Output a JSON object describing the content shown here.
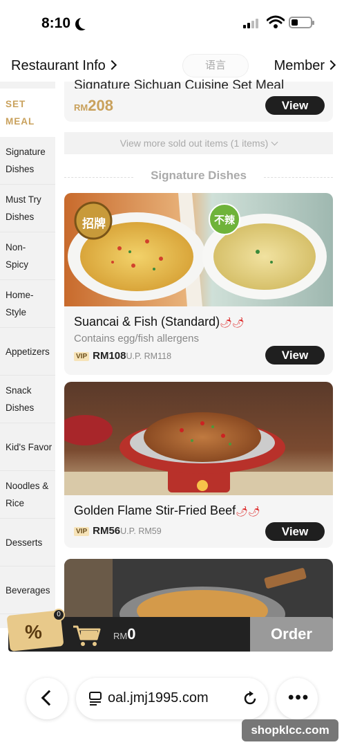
{
  "status_bar": {
    "time": "8:10"
  },
  "header": {
    "restaurant_info": "Restaurant Info",
    "language": "语言",
    "member": "Member"
  },
  "sidebar": {
    "items": [
      {
        "label": "SET MEAL",
        "active": true
      },
      {
        "label": "Signature Dishes"
      },
      {
        "label": "Must Try Dishes"
      },
      {
        "label": "Non-Spicy"
      },
      {
        "label": "Home-Style"
      },
      {
        "label": "Appetizers"
      },
      {
        "label": "Snack Dishes"
      },
      {
        "label": "Kid's Favor"
      },
      {
        "label": "Noodles & Rice"
      },
      {
        "label": "Desserts"
      },
      {
        "label": "Beverages"
      }
    ]
  },
  "set_meal_card": {
    "title": "Signature Sichuan Cuisine Set Meal",
    "currency": "RM",
    "price": "208",
    "view_label": "View"
  },
  "sold_out": {
    "label": "View more sold out items (1 items)"
  },
  "section": {
    "title": "Signature Dishes"
  },
  "dishes": [
    {
      "name": "Suancai & Fish (Standard)",
      "allergen": "Contains egg/fish allergens",
      "vip": "VIP",
      "vip_price": "RM108",
      "up_price": "U.P. RM118",
      "view_label": "View",
      "badge_left": "招牌",
      "badge_right": "不辣"
    },
    {
      "name": "Golden Flame Stir-Fried Beef",
      "vip": "VIP",
      "vip_price": "RM56",
      "up_price": "U.P. RM59",
      "view_label": "View"
    }
  ],
  "cart": {
    "coupon_symbol": "%",
    "coupon_count": "0",
    "currency": "RM",
    "total": "0",
    "order_label": "Order"
  },
  "browser": {
    "url": "oal.jmj1995.com"
  },
  "watermark": "shopklcc.com"
}
